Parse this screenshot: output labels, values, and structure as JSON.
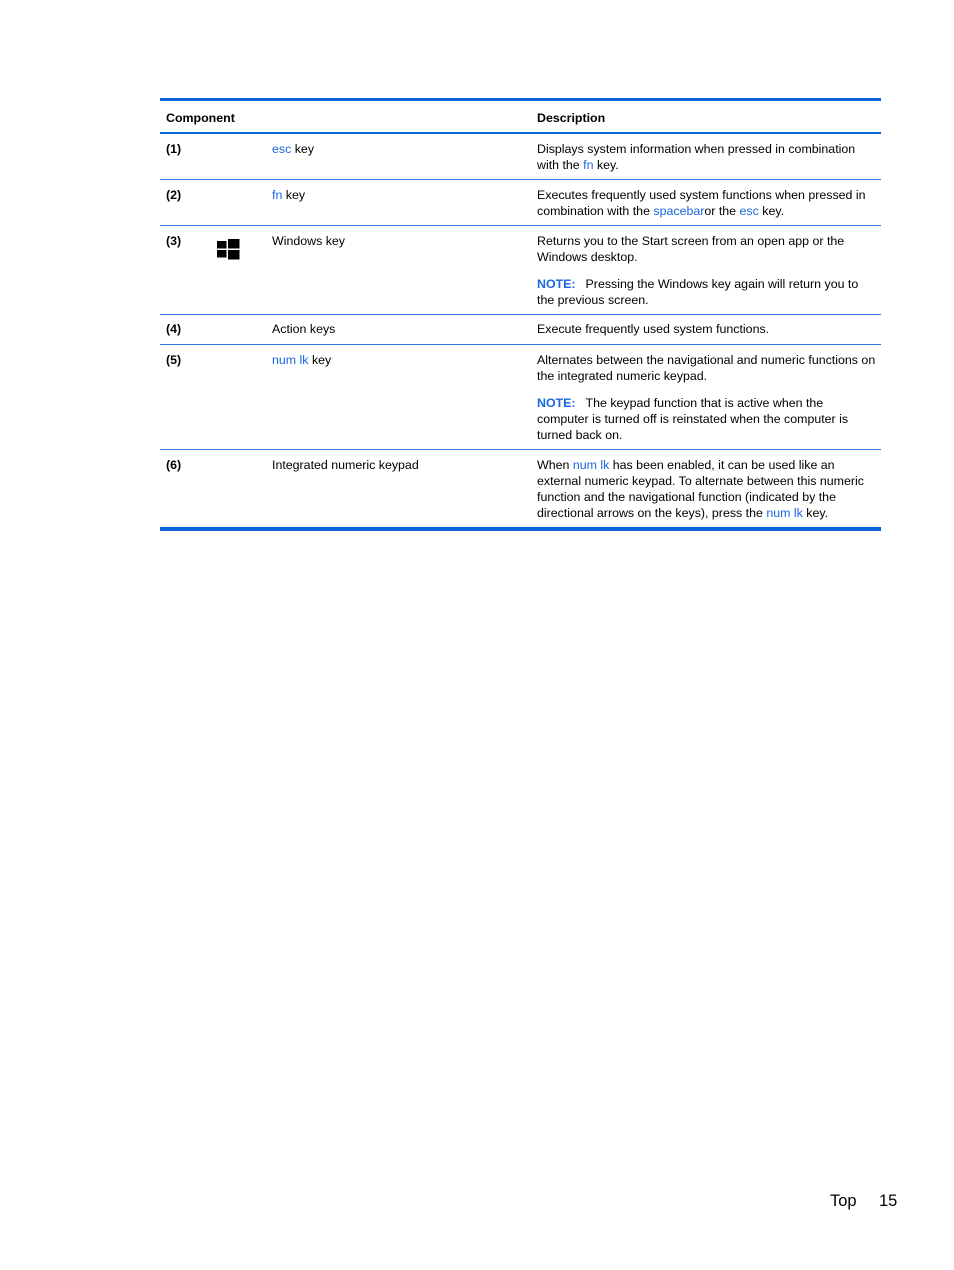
{
  "table": {
    "headers": {
      "component": "Component",
      "description": "Description"
    },
    "rows": [
      {
        "number": "(1)",
        "name_link": "esc",
        "name_rest": " key",
        "desc1": {
          "a": "Displays system information when pressed in combination with the ",
          "link1": "fn",
          "b": " key."
        }
      },
      {
        "number": "(2)",
        "name_link": "fn",
        "name_rest": " key",
        "desc1": {
          "a": "Executes frequently used system functions when pressed in combination with the ",
          "link1": "spacebar",
          "b": "or the ",
          "link2": "esc",
          "c": " key."
        }
      },
      {
        "number": "(3)",
        "icon": "windows-logo-icon",
        "name": "Windows key",
        "desc1": "Returns you to the Start screen from an open app or the Windows desktop.",
        "note_label": "NOTE:",
        "note_text": "Pressing the Windows key again will return you to the previous screen."
      },
      {
        "number": "(4)",
        "name": "Action keys",
        "desc1": "Execute frequently used system functions."
      },
      {
        "number": "(5)",
        "name_link": "num lk",
        "name_rest": " key",
        "desc1": "Alternates between the navigational and numeric functions on the integrated numeric keypad.",
        "note_label": "NOTE:",
        "note_text": "The keypad function that is active when the computer is turned off is reinstated when the computer is turned back on."
      },
      {
        "number": "(6)",
        "name": "Integrated numeric keypad",
        "desc1": {
          "a": "When ",
          "link1": "num lk",
          "b": " has been enabled, it can be used like an external numeric keypad. To alternate between this numeric function and the navigational function (indicated by the directional arrows on the keys), press the ",
          "link2": "num lk",
          "c": " key."
        }
      }
    ]
  },
  "footer": {
    "section": "Top",
    "page_number": "15"
  },
  "colors": {
    "accent": "#0a66d8",
    "link": "#1a66e0"
  }
}
